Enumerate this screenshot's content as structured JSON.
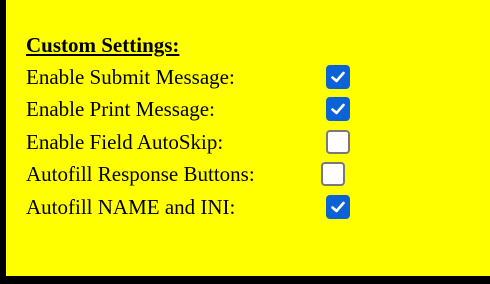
{
  "settings": {
    "title": "Custom Settings:",
    "accent_color": "#0b62d6",
    "background_color": "#ffff00",
    "items": [
      {
        "label": "Enable Submit Message:",
        "checked": true
      },
      {
        "label": "Enable Print Message:",
        "checked": true
      },
      {
        "label": "Enable Field AutoSkip:",
        "checked": false
      },
      {
        "label": "Autofill Response Buttons:",
        "checked": false
      },
      {
        "label": "Autofill NAME and INI:",
        "checked": true
      }
    ]
  }
}
